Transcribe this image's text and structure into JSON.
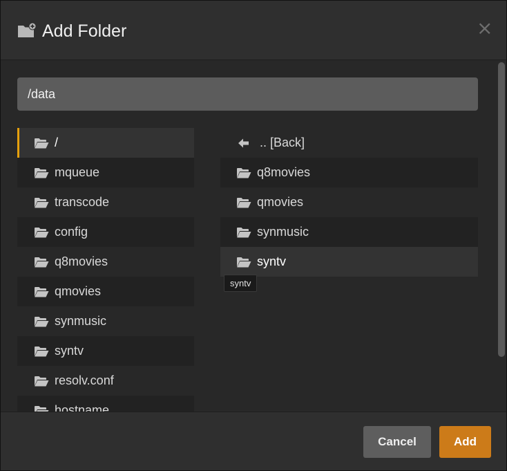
{
  "dialog": {
    "title": "Add Folder",
    "title_icon": "folder-plus-icon",
    "close_symbol": "×"
  },
  "path_input": {
    "value": "/data"
  },
  "left_list": [
    {
      "label": "/",
      "icon": "folder-open-icon",
      "selected": true
    },
    {
      "label": "mqueue",
      "icon": "folder-open-icon"
    },
    {
      "label": "transcode",
      "icon": "folder-open-icon"
    },
    {
      "label": "config",
      "icon": "folder-open-icon"
    },
    {
      "label": "q8movies",
      "icon": "folder-open-icon"
    },
    {
      "label": "qmovies",
      "icon": "folder-open-icon"
    },
    {
      "label": "synmusic",
      "icon": "folder-open-icon"
    },
    {
      "label": "syntv",
      "icon": "folder-open-icon"
    },
    {
      "label": "resolv.conf",
      "icon": "folder-open-icon"
    },
    {
      "label": "hostname",
      "icon": "folder-open-icon"
    }
  ],
  "right_list": [
    {
      "label": ".. [Back]",
      "icon": "arrow-left-icon"
    },
    {
      "label": "q8movies",
      "icon": "folder-open-icon"
    },
    {
      "label": "qmovies",
      "icon": "folder-open-icon"
    },
    {
      "label": "synmusic",
      "icon": "folder-open-icon"
    },
    {
      "label": "syntv",
      "icon": "folder-open-icon",
      "hovered": true
    }
  ],
  "tooltip": {
    "text": "syntv"
  },
  "footer": {
    "cancel_label": "Cancel",
    "add_label": "Add"
  },
  "colors": {
    "accent": "#e5a00d",
    "add_button": "#cc7b19",
    "cancel_button": "#5e5e5e",
    "input_background": "#5c5c5c",
    "panel_background": "#282828"
  }
}
